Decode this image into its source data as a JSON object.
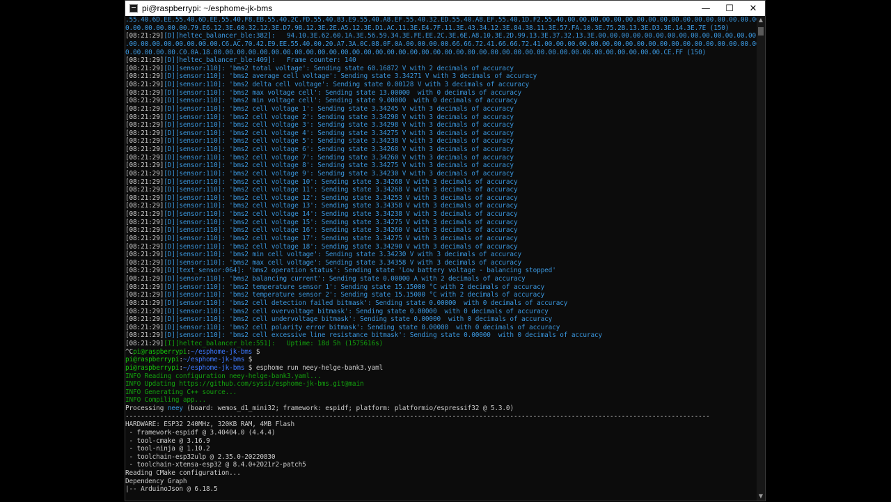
{
  "window": {
    "title": "pi@raspberrypi: ~/esphome-jk-bms",
    "minimize": "—",
    "maximize": "☐",
    "close": "✕"
  },
  "terminal": {
    "lines": [
      {
        "parts": [
          {
            "t": ".55.40.6D.EE.55.40.6D.EE.55.40.F8.EB.55.40.2C.FD.55.40.83.E9.55.40.A8.EF.55.40.32.ED.55.40.A8.EF.55.40.1D.F2.55.40.00.00.00.00.00.00.00.00.00.00.00.00.00.00.00.00.00.00.00.00.00",
            "c": "c"
          }
        ]
      },
      {
        "parts": [
          {
            "t": "0.00.00.00.00.00.79.E6.12.3E.60.32.12.3E.D7.9B.12.3E.2E.A5.12.3E.D1.AC.11.3E.E4.7F.11.3E.43.34.12.3E.84.38.11.3E.57.FA.10.3E.75.2B.13.3E.D3.3E.14.3E.7E (150)",
            "c": "c"
          }
        ]
      },
      {
        "parts": [
          {
            "t": "[08:21:29]",
            "c": "w"
          },
          {
            "t": "[D]",
            "c": "c"
          },
          {
            "t": "[heltec_balancer_ble:382]:   94.10.3E.62.60.1A.3E.56.59.34.3E.FE.EE.2C.3E.6E.A8.10.3E.2D.99.13.3E.37.32.13.3E.00.00.00.00.00.00.00.00.00.00.00.00.00.00",
            "c": "c"
          }
        ]
      },
      {
        "parts": [
          {
            "t": ".00.00.00.00.00.00.00.00.C6.AC.70.42.E9.EE.55.40.00.20.A7.3A.0C.08.0F.0A.00.00.00.00.66.66.72.41.66.66.72.41.00.00.00.00.00.00.00.00.00.00.00.00.00.00.00.00.00.00.00",
            "c": "c"
          }
        ]
      },
      {
        "parts": [
          {
            "t": "0.00.00.00.00.C0.0A.18.00.00.00.00.00.00.00.00.00.00.00.00.00.00.00.00.00.00.00.00.00.00.00.00.00.00.00.00.00.00.00.00.00.00.00.00.00.00.00.CE.FF (150)",
            "c": "c"
          }
        ]
      },
      {
        "parts": [
          {
            "t": "[08:21:29]",
            "c": "w"
          },
          {
            "t": "[D]",
            "c": "c"
          },
          {
            "t": "[heltec_balancer_ble:409]:   Frame counter: 140",
            "c": "c"
          }
        ]
      },
      {
        "parts": [
          {
            "t": "[08:21:29]",
            "c": "w"
          },
          {
            "t": "[D]",
            "c": "c"
          },
          {
            "t": "[sensor:110]: 'bms2 total voltage': Sending state 60.16872 V with 2 decimals of accuracy",
            "c": "c"
          }
        ]
      },
      {
        "parts": [
          {
            "t": "[08:21:29]",
            "c": "w"
          },
          {
            "t": "[D]",
            "c": "c"
          },
          {
            "t": "[sensor:110]: 'bms2 average cell voltage': Sending state 3.34271 V with 3 decimals of accuracy",
            "c": "c"
          }
        ]
      },
      {
        "parts": [
          {
            "t": "[08:21:29]",
            "c": "w"
          },
          {
            "t": "[D]",
            "c": "c"
          },
          {
            "t": "[sensor:110]: 'bms2 delta cell voltage': Sending state 0.00128 V with 3 decimals of accuracy",
            "c": "c"
          }
        ]
      },
      {
        "parts": [
          {
            "t": "[08:21:29]",
            "c": "w"
          },
          {
            "t": "[D]",
            "c": "c"
          },
          {
            "t": "[sensor:110]: 'bms2 max voltage cell': Sending state 13.00000  with 0 decimals of accuracy",
            "c": "c"
          }
        ]
      },
      {
        "parts": [
          {
            "t": "[08:21:29]",
            "c": "w"
          },
          {
            "t": "[D]",
            "c": "c"
          },
          {
            "t": "[sensor:110]: 'bms2 min voltage cell': Sending state 9.00000  with 0 decimals of accuracy",
            "c": "c"
          }
        ]
      },
      {
        "parts": [
          {
            "t": "[08:21:29]",
            "c": "w"
          },
          {
            "t": "[D]",
            "c": "c"
          },
          {
            "t": "[sensor:110]: 'bms2 cell voltage 1': Sending state 3.34245 V with 3 decimals of accuracy",
            "c": "c"
          }
        ]
      },
      {
        "parts": [
          {
            "t": "[08:21:29]",
            "c": "w"
          },
          {
            "t": "[D]",
            "c": "c"
          },
          {
            "t": "[sensor:110]: 'bms2 cell voltage 2': Sending state 3.34298 V with 3 decimals of accuracy",
            "c": "c"
          }
        ]
      },
      {
        "parts": [
          {
            "t": "[08:21:29]",
            "c": "w"
          },
          {
            "t": "[D]",
            "c": "c"
          },
          {
            "t": "[sensor:110]: 'bms2 cell voltage 3': Sending state 3.34298 V with 3 decimals of accuracy",
            "c": "c"
          }
        ]
      },
      {
        "parts": [
          {
            "t": "[08:21:29]",
            "c": "w"
          },
          {
            "t": "[D]",
            "c": "c"
          },
          {
            "t": "[sensor:110]: 'bms2 cell voltage 4': Sending state 3.34275 V with 3 decimals of accuracy",
            "c": "c"
          }
        ]
      },
      {
        "parts": [
          {
            "t": "[08:21:29]",
            "c": "w"
          },
          {
            "t": "[D]",
            "c": "c"
          },
          {
            "t": "[sensor:110]: 'bms2 cell voltage 5': Sending state 3.34238 V with 3 decimals of accuracy",
            "c": "c"
          }
        ]
      },
      {
        "parts": [
          {
            "t": "[08:21:29]",
            "c": "w"
          },
          {
            "t": "[D]",
            "c": "c"
          },
          {
            "t": "[sensor:110]: 'bms2 cell voltage 6': Sending state 3.34268 V with 3 decimals of accuracy",
            "c": "c"
          }
        ]
      },
      {
        "parts": [
          {
            "t": "[08:21:29]",
            "c": "w"
          },
          {
            "t": "[D]",
            "c": "c"
          },
          {
            "t": "[sensor:110]: 'bms2 cell voltage 7': Sending state 3.34260 V with 3 decimals of accuracy",
            "c": "c"
          }
        ]
      },
      {
        "parts": [
          {
            "t": "[08:21:29]",
            "c": "w"
          },
          {
            "t": "[D]",
            "c": "c"
          },
          {
            "t": "[sensor:110]: 'bms2 cell voltage 8': Sending state 3.34275 V with 3 decimals of accuracy",
            "c": "c"
          }
        ]
      },
      {
        "parts": [
          {
            "t": "[08:21:29]",
            "c": "w"
          },
          {
            "t": "[D]",
            "c": "c"
          },
          {
            "t": "[sensor:110]: 'bms2 cell voltage 9': Sending state 3.34230 V with 3 decimals of accuracy",
            "c": "c"
          }
        ]
      },
      {
        "parts": [
          {
            "t": "[08:21:29]",
            "c": "w"
          },
          {
            "t": "[D]",
            "c": "c"
          },
          {
            "t": "[sensor:110]: 'bms2 cell voltage 10': Sending state 3.34268 V with 3 decimals of accuracy",
            "c": "c"
          }
        ]
      },
      {
        "parts": [
          {
            "t": "[08:21:29]",
            "c": "w"
          },
          {
            "t": "[D]",
            "c": "c"
          },
          {
            "t": "[sensor:110]: 'bms2 cell voltage 11': Sending state 3.34268 V with 3 decimals of accuracy",
            "c": "c"
          }
        ]
      },
      {
        "parts": [
          {
            "t": "[08:21:29]",
            "c": "w"
          },
          {
            "t": "[D]",
            "c": "c"
          },
          {
            "t": "[sensor:110]: 'bms2 cell voltage 12': Sending state 3.34253 V with 3 decimals of accuracy",
            "c": "c"
          }
        ]
      },
      {
        "parts": [
          {
            "t": "[08:21:29]",
            "c": "w"
          },
          {
            "t": "[D]",
            "c": "c"
          },
          {
            "t": "[sensor:110]: 'bms2 cell voltage 13': Sending state 3.34358 V with 3 decimals of accuracy",
            "c": "c"
          }
        ]
      },
      {
        "parts": [
          {
            "t": "[08:21:29]",
            "c": "w"
          },
          {
            "t": "[D]",
            "c": "c"
          },
          {
            "t": "[sensor:110]: 'bms2 cell voltage 14': Sending state 3.34238 V with 3 decimals of accuracy",
            "c": "c"
          }
        ]
      },
      {
        "parts": [
          {
            "t": "[08:21:29]",
            "c": "w"
          },
          {
            "t": "[D]",
            "c": "c"
          },
          {
            "t": "[sensor:110]: 'bms2 cell voltage 15': Sending state 3.34275 V with 3 decimals of accuracy",
            "c": "c"
          }
        ]
      },
      {
        "parts": [
          {
            "t": "[08:21:29]",
            "c": "w"
          },
          {
            "t": "[D]",
            "c": "c"
          },
          {
            "t": "[sensor:110]: 'bms2 cell voltage 16': Sending state 3.34260 V with 3 decimals of accuracy",
            "c": "c"
          }
        ]
      },
      {
        "parts": [
          {
            "t": "[08:21:29]",
            "c": "w"
          },
          {
            "t": "[D]",
            "c": "c"
          },
          {
            "t": "[sensor:110]: 'bms2 cell voltage 17': Sending state 3.34275 V with 3 decimals of accuracy",
            "c": "c"
          }
        ]
      },
      {
        "parts": [
          {
            "t": "[08:21:29]",
            "c": "w"
          },
          {
            "t": "[D]",
            "c": "c"
          },
          {
            "t": "[sensor:110]: 'bms2 cell voltage 18': Sending state 3.34290 V with 3 decimals of accuracy",
            "c": "c"
          }
        ]
      },
      {
        "parts": [
          {
            "t": "[08:21:29]",
            "c": "w"
          },
          {
            "t": "[D]",
            "c": "c"
          },
          {
            "t": "[sensor:110]: 'bms2 min cell voltage': Sending state 3.34230 V with 3 decimals of accuracy",
            "c": "c"
          }
        ]
      },
      {
        "parts": [
          {
            "t": "[08:21:29]",
            "c": "w"
          },
          {
            "t": "[D]",
            "c": "c"
          },
          {
            "t": "[sensor:110]: 'bms2 max cell voltage': Sending state 3.34358 V with 3 decimals of accuracy",
            "c": "c"
          }
        ]
      },
      {
        "parts": [
          {
            "t": "[08:21:29]",
            "c": "w"
          },
          {
            "t": "[D]",
            "c": "c"
          },
          {
            "t": "[text_sensor:064]: 'bms2 operation status': Sending state 'Low battery voltage - balancing stopped'",
            "c": "c"
          }
        ]
      },
      {
        "parts": [
          {
            "t": "[08:21:29]",
            "c": "w"
          },
          {
            "t": "[D]",
            "c": "c"
          },
          {
            "t": "[sensor:110]: 'bms2 balancing current': Sending state 0.00000 A with 2 decimals of accuracy",
            "c": "c"
          }
        ]
      },
      {
        "parts": [
          {
            "t": "[08:21:29]",
            "c": "w"
          },
          {
            "t": "[D]",
            "c": "c"
          },
          {
            "t": "[sensor:110]: 'bms2 temperature sensor 1': Sending state 15.15000 °C with 2 decimals of accuracy",
            "c": "c"
          }
        ]
      },
      {
        "parts": [
          {
            "t": "[08:21:29]",
            "c": "w"
          },
          {
            "t": "[D]",
            "c": "c"
          },
          {
            "t": "[sensor:110]: 'bms2 temperature sensor 2': Sending state 15.15000 °C with 2 decimals of accuracy",
            "c": "c"
          }
        ]
      },
      {
        "parts": [
          {
            "t": "[08:21:29]",
            "c": "w"
          },
          {
            "t": "[D]",
            "c": "c"
          },
          {
            "t": "[sensor:110]: 'bms2 cell detection failed bitmask': Sending state 0.00000  with 0 decimals of accuracy",
            "c": "c"
          }
        ]
      },
      {
        "parts": [
          {
            "t": "[08:21:29]",
            "c": "w"
          },
          {
            "t": "[D]",
            "c": "c"
          },
          {
            "t": "[sensor:110]: 'bms2 cell overvoltage bitmask': Sending state 0.00000  with 0 decimals of accuracy",
            "c": "c"
          }
        ]
      },
      {
        "parts": [
          {
            "t": "[08:21:29]",
            "c": "w"
          },
          {
            "t": "[D]",
            "c": "c"
          },
          {
            "t": "[sensor:110]: 'bms2 cell undervoltage bitmask': Sending state 0.00000  with 0 decimals of accuracy",
            "c": "c"
          }
        ]
      },
      {
        "parts": [
          {
            "t": "[08:21:29]",
            "c": "w"
          },
          {
            "t": "[D]",
            "c": "c"
          },
          {
            "t": "[sensor:110]: 'bms2 cell polarity error bitmask': Sending state 0.00000  with 0 decimals of accuracy",
            "c": "c"
          }
        ]
      },
      {
        "parts": [
          {
            "t": "[08:21:29]",
            "c": "w"
          },
          {
            "t": "[D]",
            "c": "c"
          },
          {
            "t": "[sensor:110]: 'bms2 cell excessive line resistance bitmask': Sending state 0.00000  with 0 decimals of accuracy",
            "c": "c"
          }
        ]
      },
      {
        "parts": [
          {
            "t": "[08:21:29]",
            "c": "w"
          },
          {
            "t": "[I]",
            "c": "gi"
          },
          {
            "t": "[heltec_balancer_ble:551]:   Uptime: 18d 5h (1575616s)",
            "c": "gi"
          }
        ]
      },
      {
        "parts": [
          {
            "t": "^C",
            "c": "w"
          },
          {
            "t": "pi@raspberrypi",
            "c": "g"
          },
          {
            "t": ":",
            "c": "w"
          },
          {
            "t": "~/esphome-jk-bms",
            "c": "b"
          },
          {
            "t": " $",
            "c": "w"
          }
        ]
      },
      {
        "parts": [
          {
            "t": "pi@raspberrypi",
            "c": "g"
          },
          {
            "t": ":",
            "c": "w"
          },
          {
            "t": "~/esphome-jk-bms",
            "c": "b"
          },
          {
            "t": " $",
            "c": "w"
          }
        ]
      },
      {
        "parts": [
          {
            "t": "pi@raspberrypi",
            "c": "g"
          },
          {
            "t": ":",
            "c": "w"
          },
          {
            "t": "~/esphome-jk-bms",
            "c": "b"
          },
          {
            "t": " $ esphome run neey-helge-bank3.yaml",
            "c": "w"
          }
        ]
      },
      {
        "parts": [
          {
            "t": "INFO Reading configuration neey-helge-bank3.yaml...",
            "c": "gi"
          }
        ]
      },
      {
        "parts": [
          {
            "t": "INFO Updating https://github.com/syssi/esphome-jk-bms.git@main",
            "c": "gi"
          }
        ]
      },
      {
        "parts": [
          {
            "t": "INFO Generating C++ source...",
            "c": "gi"
          }
        ]
      },
      {
        "parts": [
          {
            "t": "INFO Compiling app...",
            "c": "gi"
          }
        ]
      },
      {
        "parts": [
          {
            "t": "Processing ",
            "c": "w"
          },
          {
            "t": "neey",
            "c": "c"
          },
          {
            "t": " (board: wemos_d1_mini32; framework: espidf; platform: platformio/espressif32 @ 5.3.0)",
            "c": "w"
          }
        ]
      },
      {
        "parts": [
          {
            "t": "--------------------------------------------------------------------------------------------------------------------------------------------------------",
            "c": "w"
          }
        ]
      },
      {
        "parts": [
          {
            "t": "HARDWARE: ESP32 240MHz, 320KB RAM, 4MB Flash",
            "c": "w"
          }
        ]
      },
      {
        "parts": [
          {
            "t": " - framework-espidf @ 3.40404.0 (4.4.4)",
            "c": "w"
          }
        ]
      },
      {
        "parts": [
          {
            "t": " - tool-cmake @ 3.16.9",
            "c": "w"
          }
        ]
      },
      {
        "parts": [
          {
            "t": " - tool-ninja @ 1.10.2",
            "c": "w"
          }
        ]
      },
      {
        "parts": [
          {
            "t": " - toolchain-esp32ulp @ 2.35.0-20220830",
            "c": "w"
          }
        ]
      },
      {
        "parts": [
          {
            "t": " - toolchain-xtensa-esp32 @ 8.4.0+2021r2-patch5",
            "c": "w"
          }
        ]
      },
      {
        "parts": [
          {
            "t": "Reading CMake configuration...",
            "c": "w"
          }
        ]
      },
      {
        "parts": [
          {
            "t": "Dependency Graph",
            "c": "w"
          }
        ]
      },
      {
        "parts": [
          {
            "t": "|-- ArduinoJson @ 6.18.5",
            "c": "w"
          }
        ]
      }
    ]
  },
  "scrollbar": {
    "up": "▲",
    "down": "▼"
  }
}
